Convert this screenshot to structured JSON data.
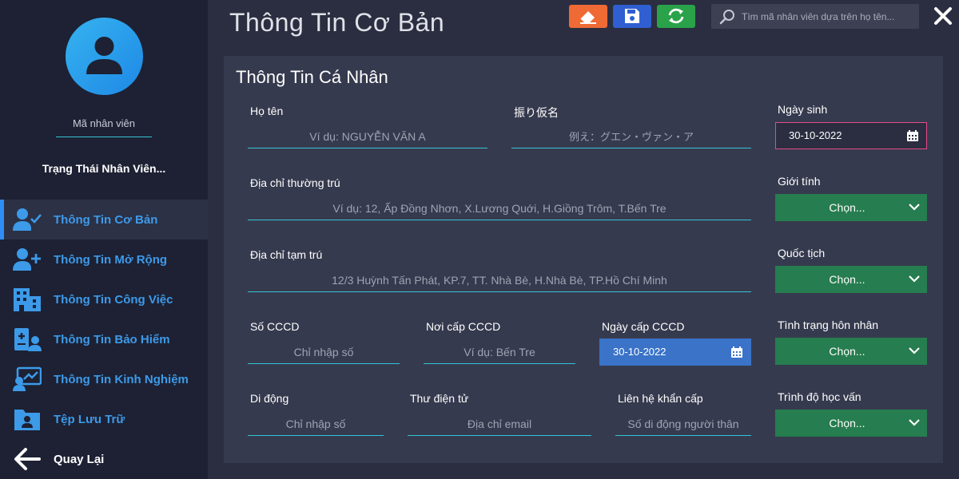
{
  "sidebar": {
    "employee_id_label": "Mã nhân viên",
    "status": "Trạng Thái Nhân Viên...",
    "nav": [
      {
        "label": "Thông Tin Cơ Bản",
        "icon": "user-check-icon",
        "active": true
      },
      {
        "label": "Thông Tin Mở Rộng",
        "icon": "user-plus-icon"
      },
      {
        "label": "Thông Tin Công Việc",
        "icon": "building-icon"
      },
      {
        "label": "Thông Tin Bảo Hiểm",
        "icon": "insurance-icon"
      },
      {
        "label": "Thông Tin Kinh Nghiệm",
        "icon": "chart-user-icon"
      },
      {
        "label": "Tệp Lưu Trữ",
        "icon": "folder-user-icon"
      },
      {
        "label": "Quay Lại",
        "icon": "arrow-left-icon"
      }
    ]
  },
  "header": {
    "title": "Thông Tin Cơ Bản",
    "search_placeholder": "Tìm mã nhân viên dựa trên họ tên..."
  },
  "form": {
    "section_title": "Thông Tin Cá Nhân",
    "full_name": {
      "label": "Họ tên",
      "placeholder": "Ví dụ: NGUYỄN VĂN A"
    },
    "furigana": {
      "label": "振り仮名",
      "placeholder": "例え：グエン・ヴァン・ア"
    },
    "permanent_address": {
      "label": "Địa chỉ thường trú",
      "placeholder": "Ví dụ: 12, Ấp Đồng Nhơn, X.Lương Quới, H.Giồng Trôm, T.Bến Tre"
    },
    "temporary_address": {
      "label": "Địa chỉ tạm trú",
      "placeholder": "12/3 Huỳnh Tấn Phát, KP.7, TT. Nhà Bè, H.Nhà Bè, TP.Hồ Chí Minh"
    },
    "id_number": {
      "label": "Số CCCD",
      "placeholder": "Chỉ nhập số"
    },
    "id_place": {
      "label": "Nơi cấp CCCD",
      "placeholder": "Ví dụ: Bến Tre"
    },
    "id_date": {
      "label": "Ngày cấp CCCD",
      "value": "30-10-2022"
    },
    "mobile": {
      "label": "Di động",
      "placeholder": "Chỉ nhập số"
    },
    "email": {
      "label": "Thư điện tử",
      "placeholder": "Địa chỉ email"
    },
    "emergency": {
      "label": "Liên hệ khẩn cấp",
      "placeholder": "Số di động người thân"
    },
    "birth_date": {
      "label": "Ngày sinh",
      "value": "30-10-2022"
    },
    "gender": {
      "label": "Giới tính",
      "value": "Chọn..."
    },
    "nationality": {
      "label": "Quốc tịch",
      "value": "Chọn..."
    },
    "marital": {
      "label": "Tình trạng hôn nhân",
      "value": "Chọn..."
    },
    "education": {
      "label": "Trình độ học vấn",
      "value": "Chọn..."
    }
  },
  "colors": {
    "accent_blue": "#3d9ae9",
    "clear_button": "#ef6a34",
    "save_button": "#2f5fd1",
    "refresh_button": "#2aa24a",
    "select_green": "#267d4f",
    "underline": "#35c3d6"
  }
}
